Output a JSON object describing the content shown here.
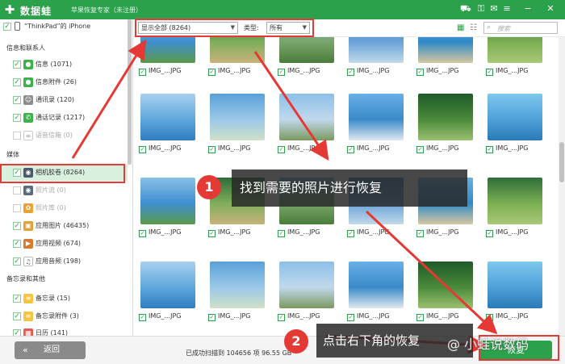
{
  "window": {
    "app_name": "数据蛙",
    "subtitle": "苹果恢复专家（未注册）"
  },
  "sidebar": {
    "device": "“ThinkPad”的 iPhone",
    "sections": [
      "信息和联系人",
      "媒体",
      "备忘录和其他"
    ],
    "items": [
      {
        "label": "信息 (1071)",
        "icon": "message-icon",
        "checked": true
      },
      {
        "label": "信息附件 (26)",
        "icon": "attachment-icon",
        "checked": true
      },
      {
        "label": "通讯录 (120)",
        "icon": "contacts-icon",
        "checked": true
      },
      {
        "label": "通话记录 (1217)",
        "icon": "phone-icon",
        "checked": true
      },
      {
        "label": "语音信箱 (0)",
        "icon": "voicemail-icon",
        "checked": false
      },
      {
        "label": "相机胶卷 (8264)",
        "icon": "camera-icon",
        "checked": true
      },
      {
        "label": "照片流 (0)",
        "icon": "photostream-icon",
        "checked": false
      },
      {
        "label": "照片库 (0)",
        "icon": "photo-library-icon",
        "checked": false
      },
      {
        "label": "应用图片 (46435)",
        "icon": "app-image-icon",
        "checked": true
      },
      {
        "label": "应用视频 (674)",
        "icon": "app-video-icon",
        "checked": true
      },
      {
        "label": "应用音频 (198)",
        "icon": "app-audio-icon",
        "checked": true
      },
      {
        "label": "备忘录 (15)",
        "icon": "notes-icon",
        "checked": true
      },
      {
        "label": "备忘录附件 (3)",
        "icon": "notes-attachment-icon",
        "checked": true
      },
      {
        "label": "日历 (141)",
        "icon": "calendar-icon",
        "checked": true
      }
    ]
  },
  "toolbar": {
    "filter_value": "显示全部 (8264)",
    "type_label": "类型:",
    "type_value": "所有",
    "search_placeholder": "搜索"
  },
  "grid": {
    "caption": "IMG_...JPG"
  },
  "bottom": {
    "back_label": "返回",
    "status": "已成功扫描到 104656 项 96.55 GB",
    "recover_label": "恢复"
  },
  "annotations": {
    "step1_number": "1",
    "step1_text": "找到需要的照片进行恢复",
    "step2_number": "2",
    "step2_text": "点击右下角的恢复",
    "watermark": "@ 小蛙说数码"
  },
  "colors": {
    "brand_green": "#2aa14a",
    "annotation_red": "#e53935"
  }
}
